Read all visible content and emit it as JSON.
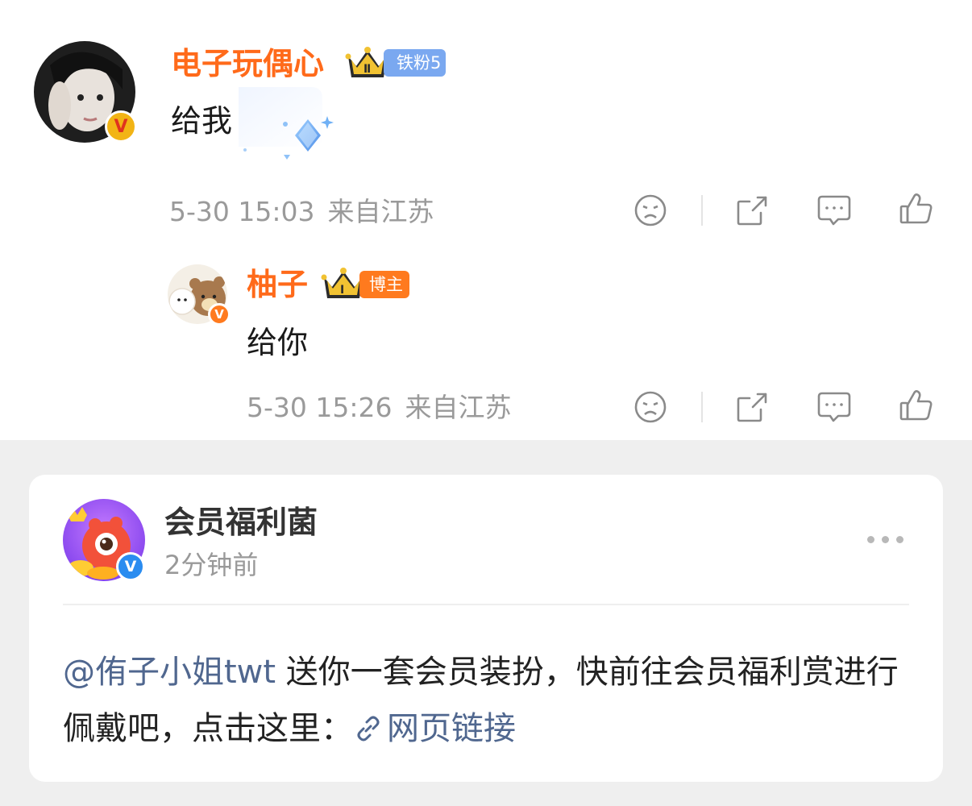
{
  "comments": [
    {
      "username": "电子玩偶心",
      "fan_badge": "铁粉5",
      "crown_level": "Ⅱ",
      "text": "给我",
      "date": "5-30 15:03",
      "location": "来自江苏",
      "avatar_badge": "V"
    },
    {
      "username": "柚子",
      "fan_badge": "博主",
      "crown_level": "Ⅰ",
      "text": "给你",
      "date": "5-30 15:26",
      "location": "来自江苏",
      "avatar_badge": "V"
    }
  ],
  "post": {
    "poster_name": "会员福利菌",
    "time_ago": "2分钟前",
    "mention": "@侑子小姐twt",
    "body_text": " 送你一套会员装扮，快前往会员福利赏进行佩戴吧，点击这里：",
    "link_text": "网页链接",
    "avatar_badge": "V"
  },
  "icons": [
    "dislike-icon",
    "share-icon",
    "comment-icon",
    "like-icon",
    "link-icon",
    "more-icon",
    "crown-icon",
    "diamond-decoration-icon"
  ],
  "colors": {
    "username": "#ff6a1a",
    "fan_badge_blue": "#7aa8f0",
    "blogger_badge_orange": "#ff7a1e",
    "link": "#50678f",
    "meta_gray": "#9a9a9a",
    "gold_badge": "#f2b415",
    "blue_verify": "#2a8cf0"
  }
}
